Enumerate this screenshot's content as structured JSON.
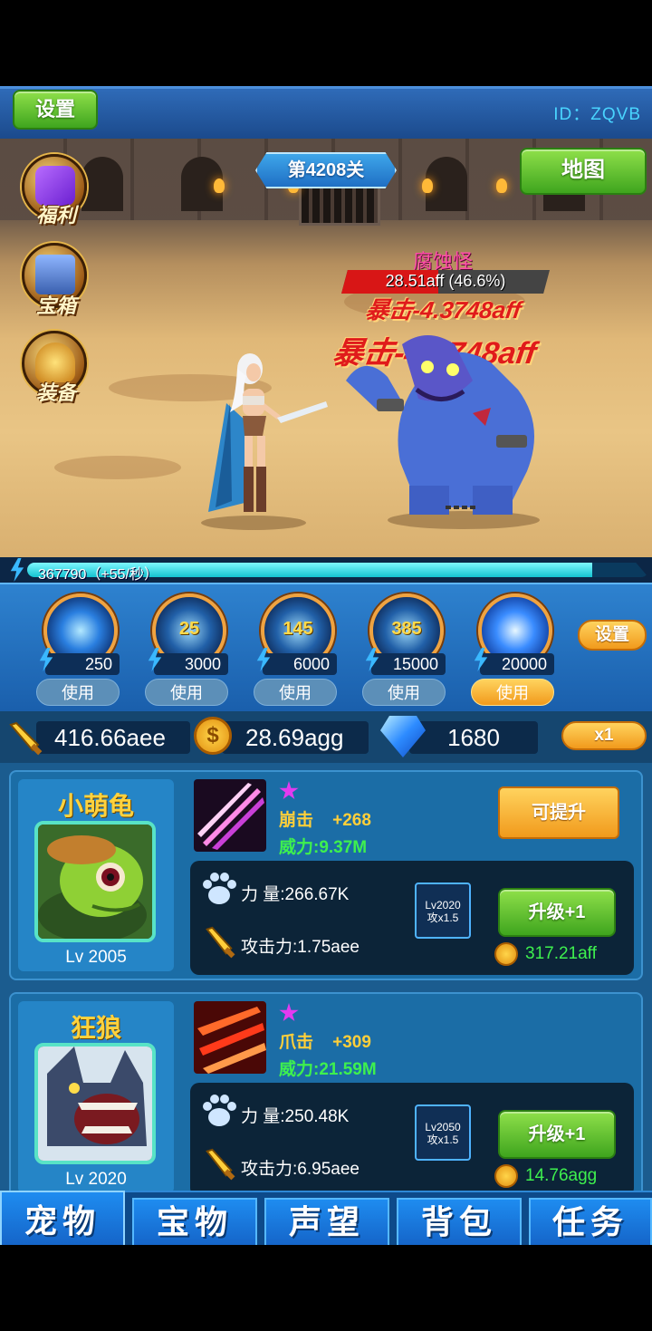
{
  "header": {
    "settings_label": "设置",
    "player_id": "ID：ZQVB"
  },
  "battle": {
    "stage_label": "第4208关",
    "map_label": "地图",
    "side_menu": [
      {
        "label": "福利",
        "icon": "gift-icon"
      },
      {
        "label": "宝箱",
        "icon": "treasure-chest-icon"
      },
      {
        "label": "装备",
        "icon": "helmet-icon"
      }
    ],
    "enemy": {
      "name": "腐蚀怪",
      "hp_text": "28.51aff (46.6%)",
      "hp_fraction": 0.466
    },
    "damage_popups": [
      "暴击-4.3748aff",
      "暴击-4.3748aff"
    ]
  },
  "energy": {
    "text": "367790（+55/秒）",
    "fill_fraction": 0.91
  },
  "skills": {
    "items": [
      {
        "cooldown": "",
        "cost": "250",
        "use_label": "使用",
        "active": false
      },
      {
        "cooldown": "25",
        "cost": "3000",
        "use_label": "使用",
        "active": false
      },
      {
        "cooldown": "145",
        "cost": "6000",
        "use_label": "使用",
        "active": false
      },
      {
        "cooldown": "385",
        "cost": "15000",
        "use_label": "使用",
        "active": false
      },
      {
        "cooldown": "",
        "cost": "20000",
        "use_label": "使用",
        "active": true
      }
    ],
    "settings_label": "设置"
  },
  "currency": {
    "attack": "416.66aee",
    "gold": "28.69agg",
    "gold_symbol": "$",
    "gems": "1680",
    "speed_label": "x1"
  },
  "pets": [
    {
      "name": "小萌龟",
      "level": "Lv 2005",
      "skill_name": "崩击",
      "skill_bonus": "+268",
      "power": "威力:9.37M",
      "strength": "力  量:266.67K",
      "attack": "攻击力:1.75aee",
      "equip_line1": "Lv2020",
      "equip_line2": "攻x1.5",
      "upgradable_label": "可提升",
      "upgrade_label": "升级+1",
      "cost": "317.21aff"
    },
    {
      "name": "狂狼",
      "level": "Lv 2020",
      "skill_name": "爪击",
      "skill_bonus": "+309",
      "power": "威力:21.59M",
      "strength": "力  量:250.48K",
      "attack": "攻击力:6.95aee",
      "equip_line1": "Lv2050",
      "equip_line2": "攻x1.5",
      "upgrade_label": "升级+1",
      "cost": "14.76agg"
    }
  ],
  "nav": {
    "tabs": [
      "宠物",
      "宝物",
      "声望",
      "背包",
      "任务"
    ],
    "active_index": 0
  },
  "colors": {
    "accent_blue": "#1e8cf0",
    "enemy_name": "#ff4ea8",
    "damage_red": "#e01b1b",
    "cost_green": "#3ef04e",
    "pet_name_gold": "#ffd23d"
  }
}
